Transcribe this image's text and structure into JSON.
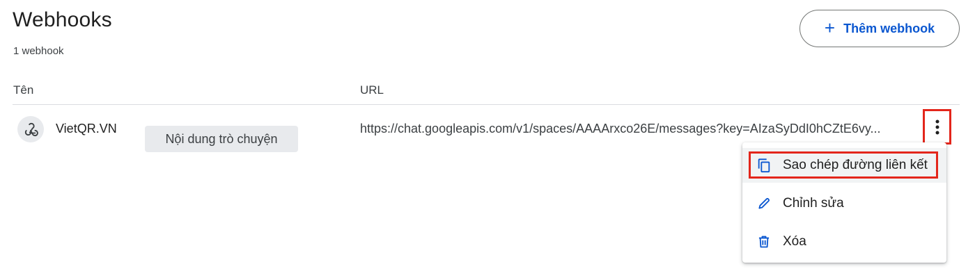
{
  "header": {
    "title": "Webhooks",
    "count": "1 webhook",
    "add_button_label": "Thêm webhook",
    "add_button_icon": "plus-icon"
  },
  "table": {
    "columns": [
      "Tên",
      "URL"
    ],
    "rows": [
      {
        "name": "VietQR.VN",
        "icon": "webhook-icon",
        "url": "https://chat.googleapis.com/v1/spaces/AAAArxco26E/messages?key=AIzaSyDdI0hCZtE6vy..."
      }
    ]
  },
  "tooltip": "Nội dung trò chuyện",
  "menu": {
    "items": [
      {
        "label": "Sao chép đường liên kết",
        "icon": "copy-icon"
      },
      {
        "label": "Chỉnh sửa",
        "icon": "pencil-icon"
      },
      {
        "label": "Xóa",
        "icon": "trash-icon"
      }
    ]
  },
  "colors": {
    "accent": "#0b57d0",
    "highlight": "#e3261b",
    "text": "#1f1f1f",
    "divider": "#dadce0"
  }
}
